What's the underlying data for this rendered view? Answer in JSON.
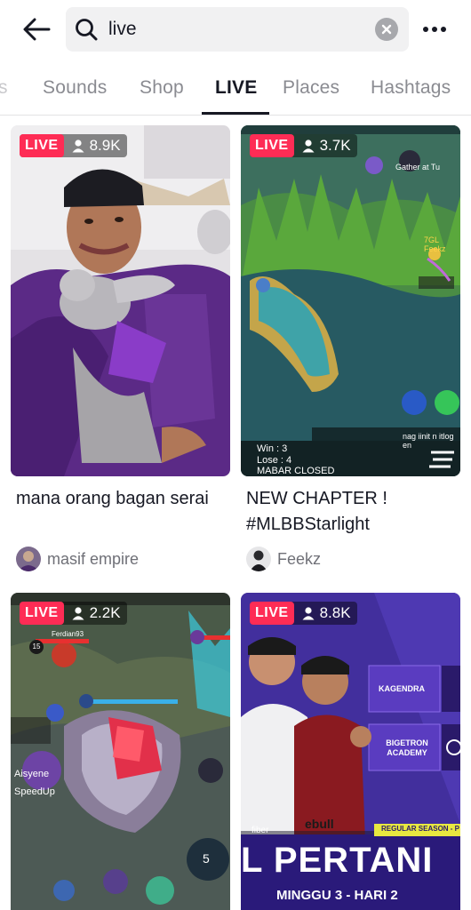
{
  "search": {
    "query": "live"
  },
  "tabs": [
    {
      "label": "s"
    },
    {
      "label": "Sounds"
    },
    {
      "label": "Shop"
    },
    {
      "label": "LIVE"
    },
    {
      "label": "Places"
    },
    {
      "label": "Hashtags"
    }
  ],
  "active_tab": "LIVE",
  "cards": [
    {
      "live_label": "LIVE",
      "viewers": "8.9K",
      "title": "mana orang bagan serai",
      "author": "masif empire"
    },
    {
      "live_label": "LIVE",
      "viewers": "3.7K",
      "title": "NEW CHAPTER ! #MLBBStarlight",
      "author": "Feekz",
      "thumb_text": {
        "win": "Win : 3",
        "lose": "Lose : 4",
        "status": "MABAR CLOSED",
        "chat": "nag iinit n itlog en",
        "player": "7GL Feekz",
        "notice": "Gather at Tu"
      }
    },
    {
      "live_label": "LIVE",
      "viewers": "2.2K",
      "thumb_text": {
        "player_top": "Ferdian93",
        "player_left": "Aisyene",
        "player_left2": "SpeedUp",
        "level": "15",
        "ult": "5"
      }
    },
    {
      "live_label": "LIVE",
      "viewers": "8.8K",
      "thumb_text": {
        "team1": "KAGENDRA",
        "team2": "BIGETRON ACADEMY",
        "season": "REGULAR SEASON - P",
        "headline": "L PERTANI",
        "week": "MINGGU 3 - HARI 2",
        "sponsor": "fiber",
        "jersey": "ebull"
      }
    }
  ],
  "colors": {
    "live_red": "#fe2c55",
    "text_primary": "#161823",
    "text_secondary": "#8a8b91"
  }
}
